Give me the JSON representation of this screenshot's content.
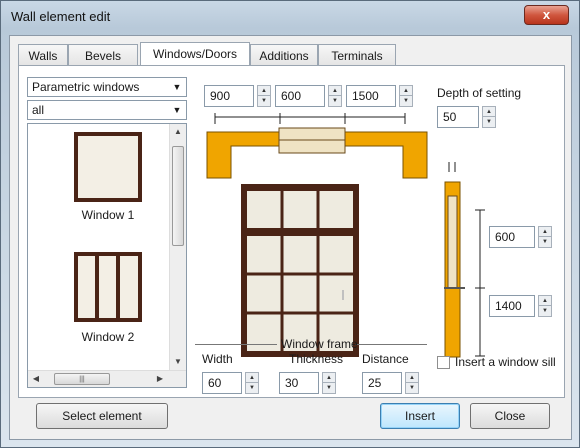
{
  "window": {
    "title": "Wall element edit",
    "close_glyph": "x"
  },
  "tabs": [
    "Walls",
    "Bevels",
    "Windows/Doors",
    "Additions",
    "Terminals"
  ],
  "active_tab": "Windows/Doors",
  "type_combo": {
    "value": "Parametric windows"
  },
  "filter_combo": {
    "value": "all"
  },
  "windows_list": [
    {
      "label": "Window 1"
    },
    {
      "label": "Window 2"
    }
  ],
  "dimensions": {
    "left": "900",
    "middle": "600",
    "right": "1500"
  },
  "depth": {
    "label": "Depth of setting",
    "value": "50"
  },
  "side": {
    "upper": "600",
    "lower": "1400"
  },
  "frame": {
    "legend": "Window frame",
    "width_label": "Width",
    "width_value": "60",
    "thickness_label": "Thickness",
    "thickness_value": "30",
    "distance_label": "Distance",
    "distance_value": "25"
  },
  "sill": {
    "label": "Insert a window sill",
    "checked": false
  },
  "buttons": {
    "select": "Select element",
    "insert": "Insert",
    "close": "Close"
  },
  "colors": {
    "wall": "#f0a500",
    "frame": "#4a2416",
    "glass": "#eeebe0"
  }
}
